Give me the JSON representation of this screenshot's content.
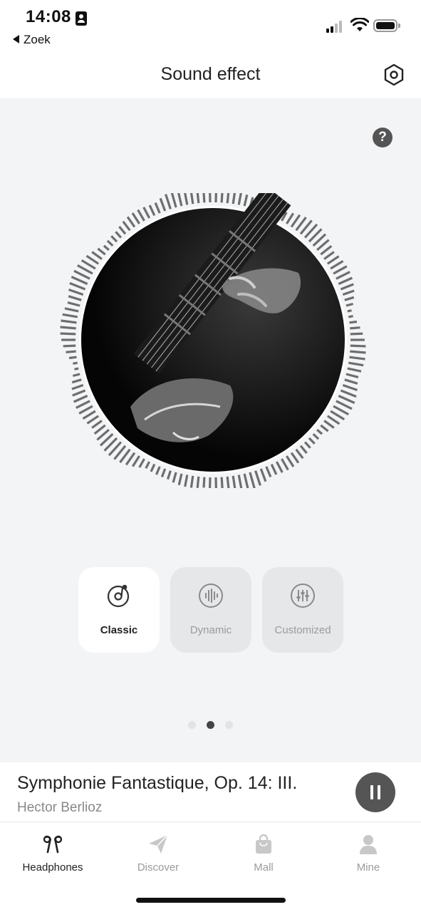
{
  "status_bar": {
    "time": "14:08",
    "back_label": "Zoek"
  },
  "header": {
    "title": "Sound effect"
  },
  "main": {
    "help_label": "?",
    "modes": [
      {
        "label": "Classic",
        "icon": "vinyl-note-icon",
        "active": true
      },
      {
        "label": "Dynamic",
        "icon": "waveform-icon",
        "active": false
      },
      {
        "label": "Customized",
        "icon": "equalizer-sliders-icon",
        "active": false
      }
    ],
    "page_indicator": {
      "count": 3,
      "active_index": 1
    }
  },
  "now_playing": {
    "title": "Symphonie Fantastique, Op. 14: III.",
    "artist": "Hector Berlioz"
  },
  "tabs": [
    {
      "label": "Headphones",
      "icon": "earbuds-icon",
      "active": true
    },
    {
      "label": "Discover",
      "icon": "paper-plane-icon",
      "active": false
    },
    {
      "label": "Mall",
      "icon": "shopping-bag-icon",
      "active": false
    },
    {
      "label": "Mine",
      "icon": "person-icon",
      "active": false
    }
  ],
  "colors": {
    "background": "#f3f4f6",
    "accent_dark": "#555555",
    "inactive_text": "#9b9b9b"
  }
}
